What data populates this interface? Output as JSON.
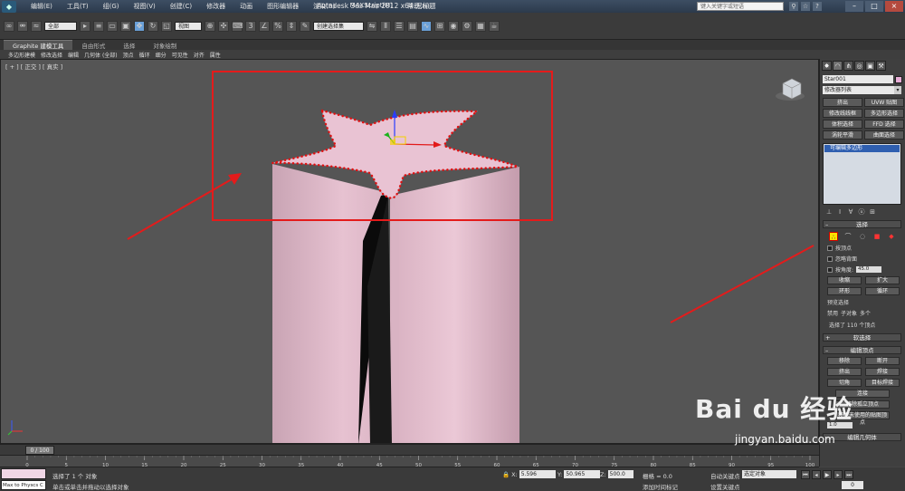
{
  "window": {
    "title": "Autodesk 3ds Max  2012 x64    无标题",
    "help_search_placeholder": "键入关键字或短语",
    "menu": [
      "编辑(E)",
      "工具(T)",
      "组(G)",
      "视图(V)",
      "创建(C)",
      "修改器",
      "动画",
      "图形编辑器",
      "渲染(R)",
      "MAXScript(M)",
      "帮助(H)"
    ]
  },
  "toolbar": {
    "filter_dropdown": "全部",
    "view_dropdown": "视图",
    "named_selection_dropdown": "创建选择集"
  },
  "ribbon": {
    "tabs": [
      "Graphite 建模工具",
      "自由形式",
      "选择",
      "对象绘制"
    ],
    "active_tab": "Graphite 建模工具",
    "items": [
      "多边形建模",
      "修改选择",
      "编辑",
      "几何体 (全部)",
      "顶点",
      "循环",
      "细分",
      "可见性",
      "对齐",
      "属性"
    ]
  },
  "viewport": {
    "label": "[ + ] [ 正交 ] [ 真实 ]",
    "object_color": "#e9c3d3",
    "annotation_color": "#e41b1b"
  },
  "command_panel": {
    "tabs": [
      "create-icon",
      "modify-icon",
      "hierarchy-icon",
      "motion-icon",
      "display-icon",
      "utilities-icon"
    ],
    "object_name": "Star001",
    "object_color": "#e9aed8",
    "modifier_list": "修改器列表",
    "modifier_buttons": [
      "挤出",
      "UVW 贴图",
      "修改线线框",
      "多边形选择",
      "体积选择",
      "FFD 选择",
      "涡轮平滑",
      "曲面选择"
    ],
    "stack_item": "可编辑多边形",
    "selection_rollout": "选择",
    "by_vertex": "按顶点",
    "ignore_backfacing": "忽略背面",
    "by_angle": "按角度:",
    "angle_value": "45.0",
    "shrink": "收缩",
    "grow": "扩大",
    "ring": "环形",
    "loop": "循环",
    "preview_selection": "预览选择",
    "preview_options": [
      "禁用",
      "子对象",
      "多个"
    ],
    "selected_count": "选择了 110 个顶点",
    "soft_selection": "软选择",
    "edit_vertices": "编辑顶点",
    "edit_vertex_buttons": [
      "移除",
      "断开",
      "挤出",
      "焊接",
      "切角",
      "目标焊接",
      "连接"
    ],
    "remove_isolated": "移除孤立顶点",
    "remove_unused_map": "移除未使用的贴图顶点",
    "weight_value": "1.0",
    "edit_geometry": "编辑几何体",
    "repeat_last": "重复上一个"
  },
  "timeline": {
    "frame_label": "0 / 100",
    "ticks": [
      "0",
      "5",
      "10",
      "15",
      "20",
      "25",
      "30",
      "35",
      "40",
      "45",
      "50",
      "55",
      "60",
      "65",
      "70",
      "75",
      "80",
      "85",
      "90",
      "95",
      "100"
    ]
  },
  "status": {
    "listener_text": "Max to Physcs C",
    "selected": "选择了 1 个 对象",
    "prompt": "单击或单击并拖动以选择对象",
    "x_label": "X:",
    "x_value": "5.596",
    "y_label": "Y:",
    "y_value": "50.965",
    "z_label": "Z:",
    "z_value": "500.0",
    "grid": "栅格 = 0.0",
    "add_time_tag": "添加时间标记",
    "auto_key": "自动关键点",
    "set_key": "设置关键点",
    "selection_set": "选定对象",
    "key_filters": "关键点过滤器...",
    "frame": "0"
  },
  "watermark": {
    "brand": "Bai du 经验",
    "url": "jingyan.baidu.com"
  }
}
